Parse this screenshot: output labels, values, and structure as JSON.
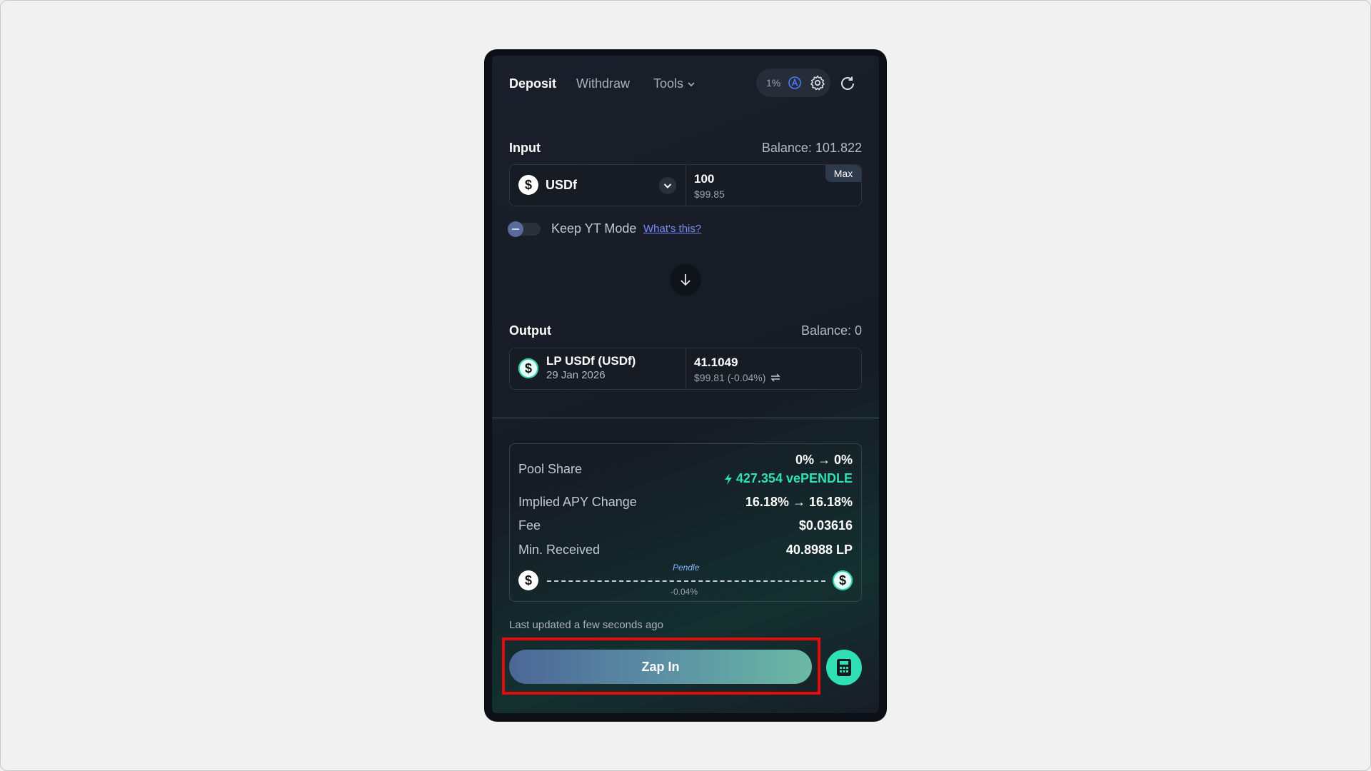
{
  "tabs": {
    "deposit": "Deposit",
    "withdraw": "Withdraw",
    "tools": "Tools"
  },
  "settings": {
    "slippage": "1%"
  },
  "input": {
    "label": "Input",
    "balance": "Balance: 101.822",
    "token": "USDf",
    "amount": "100",
    "usd_value": "$99.85",
    "max_label": "Max"
  },
  "keep_yt": {
    "label": "Keep YT Mode",
    "link": "What's this?"
  },
  "output": {
    "label": "Output",
    "balance": "Balance: 0",
    "token": "LP USDf (USDf)",
    "maturity": "29 Jan 2026",
    "amount": "41.1049",
    "usd_value": "$99.81 (-0.04%)"
  },
  "details": {
    "pool_share_label": "Pool Share",
    "pool_share_value": "0% → 0%",
    "vependle": "427.354 vePENDLE",
    "implied_apy_label": "Implied APY Change",
    "implied_apy_value": "16.18% → 16.18%",
    "fee_label": "Fee",
    "fee_value": "$0.03616",
    "min_received_label": "Min. Received",
    "min_received_value": "40.8988 LP",
    "route_provider": "Pendle",
    "route_impact": "-0.04%"
  },
  "last_updated": "Last updated a few seconds ago",
  "zap_button": "Zap In",
  "colors": {
    "accent_green": "#2fe0b5",
    "highlight_red": "#e30b0b",
    "card_bg": "#1a1f2a"
  }
}
